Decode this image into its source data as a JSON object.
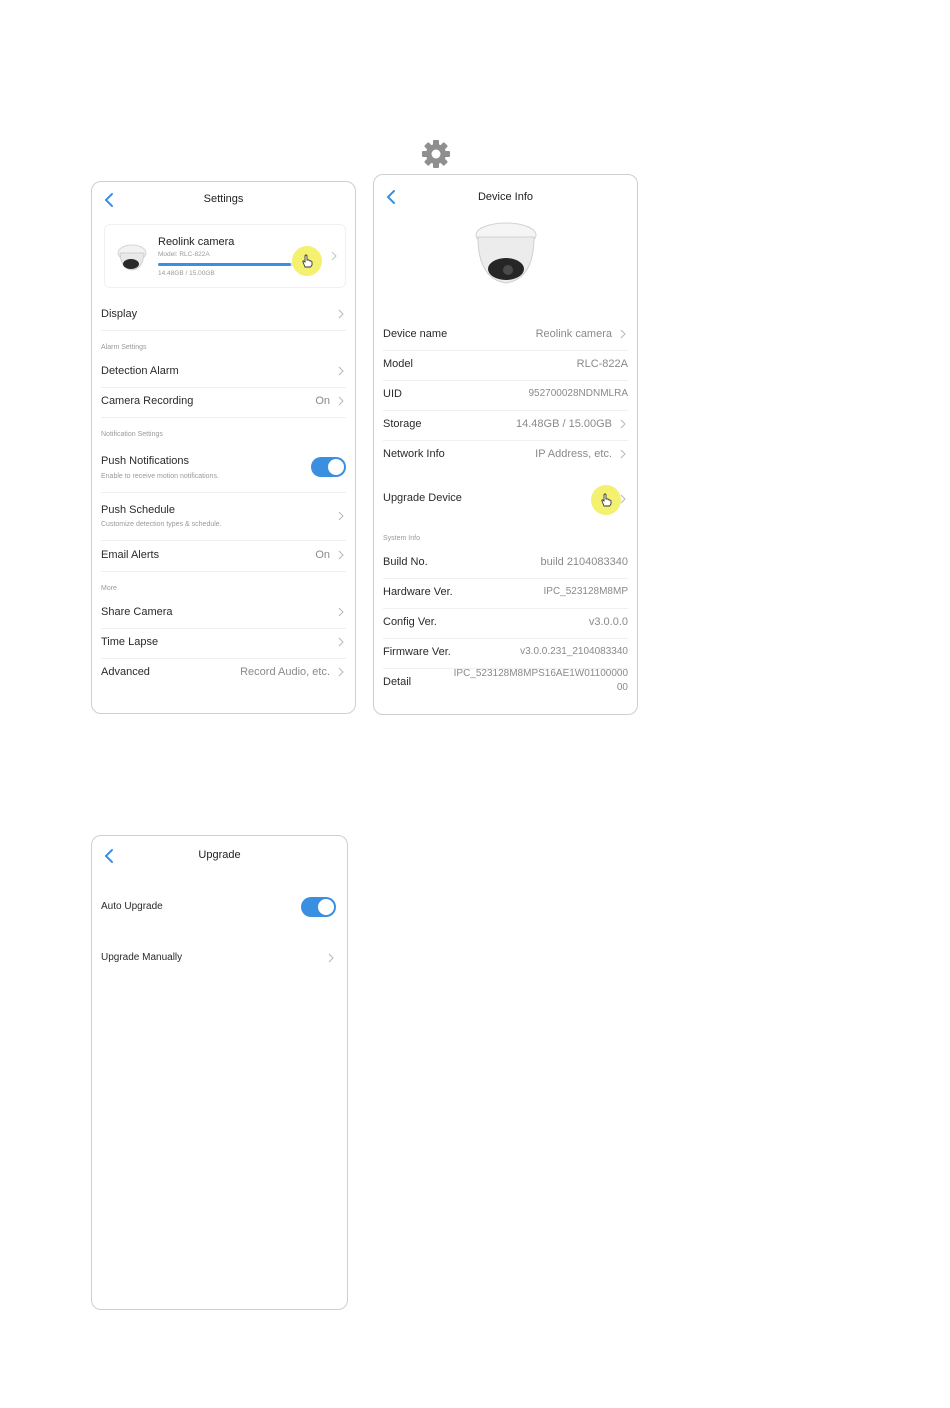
{
  "settings": {
    "title": "Settings",
    "camera": {
      "name": "Reolink camera",
      "model": "Model: RLC-822A",
      "storage": "14.48GB / 15.00GB",
      "storage_fill": 0.965
    },
    "display": "Display",
    "alarm_section": "Alarm Settings",
    "detection_alarm": "Detection Alarm",
    "camera_recording": {
      "label": "Camera Recording",
      "value": "On"
    },
    "notification_section": "Notification Settings",
    "push_notifications": {
      "label": "Push Notifications",
      "sub": "Enable to receive motion notifications.",
      "enabled": true
    },
    "push_schedule": {
      "label": "Push Schedule",
      "sub": "Customize detection types & schedule."
    },
    "email_alerts": {
      "label": "Email Alerts",
      "value": "On"
    },
    "more_section": "More",
    "share_camera": "Share Camera",
    "time_lapse": "Time Lapse",
    "advanced": {
      "label": "Advanced",
      "value": "Record Audio, etc."
    }
  },
  "device_info": {
    "title": "Device Info",
    "device_name": {
      "label": "Device name",
      "value": "Reolink camera"
    },
    "model": {
      "label": "Model",
      "value": "RLC-822A"
    },
    "uid": {
      "label": "UID",
      "value": "952700028NDNMLRA"
    },
    "storage": {
      "label": "Storage",
      "value": "14.48GB / 15.00GB"
    },
    "network": {
      "label": "Network Info",
      "value": "IP Address, etc."
    },
    "upgrade": "Upgrade Device",
    "system_section": "System Info",
    "build": {
      "label": "Build No.",
      "value": "build 2104083340"
    },
    "hardware": {
      "label": "Hardware Ver.",
      "value": "IPC_523128M8MP"
    },
    "config": {
      "label": "Config Ver.",
      "value": "v3.0.0.0"
    },
    "firmware": {
      "label": "Firmware Ver.",
      "value": "v3.0.0.231_2104083340"
    },
    "detail": {
      "label": "Detail",
      "value_line1": "IPC_523128M8MPS16AE1W01100000",
      "value_line2": "00"
    }
  },
  "upgrade": {
    "title": "Upgrade",
    "auto_upgrade": {
      "label": "Auto Upgrade",
      "enabled": true
    },
    "manual": "Upgrade Manually"
  },
  "colors": {
    "accent": "#3b8fe0",
    "highlight": "#f4f070"
  }
}
